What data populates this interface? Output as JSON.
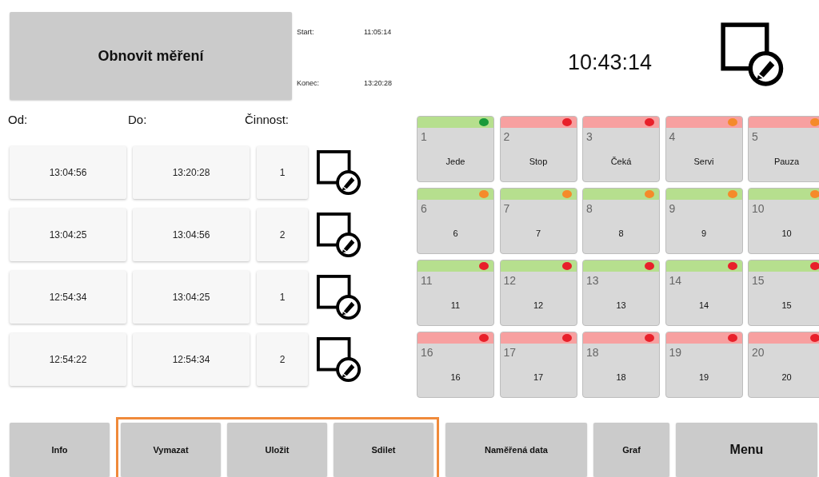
{
  "refresh_button": "Obnovit měření",
  "times": [
    {
      "label": "Start:",
      "value": "11:05:14"
    },
    {
      "label": "Konec:",
      "value": "13:20:28"
    }
  ],
  "clock": "10:43:14",
  "headers": [
    "Od:",
    "Do:",
    "Činnost:"
  ],
  "rows": [
    {
      "from": "13:04:56",
      "to": "13:20:28",
      "activity": "1"
    },
    {
      "from": "13:04:25",
      "to": "13:04:56",
      "activity": "2"
    },
    {
      "from": "12:54:34",
      "to": "13:04:25",
      "activity": "1"
    },
    {
      "from": "12:54:22",
      "to": "12:54:34",
      "activity": "2"
    }
  ],
  "tiles": [
    {
      "number": "1",
      "label": "Jede",
      "active": true,
      "color": "#1a9a3a"
    },
    {
      "number": "2",
      "label": "Stop",
      "active": false,
      "color": "#e8202a"
    },
    {
      "number": "3",
      "label": "Čeká",
      "active": false,
      "color": "#e8202a"
    },
    {
      "number": "4",
      "label": "Servi",
      "active": false,
      "color": "#f58a2a"
    },
    {
      "number": "5",
      "label": "Pauza",
      "active": false,
      "color": "#f58a2a"
    },
    {
      "number": "6",
      "label": "6",
      "active": true,
      "color": "#f58a2a"
    },
    {
      "number": "7",
      "label": "7",
      "active": true,
      "color": "#f58a2a"
    },
    {
      "number": "8",
      "label": "8",
      "active": true,
      "color": "#f58a2a"
    },
    {
      "number": "9",
      "label": "9",
      "active": true,
      "color": "#f58a2a"
    },
    {
      "number": "10",
      "label": "10",
      "active": true,
      "color": "#f58a2a"
    },
    {
      "number": "11",
      "label": "11",
      "active": true,
      "color": "#e8202a"
    },
    {
      "number": "12",
      "label": "12",
      "active": true,
      "color": "#e8202a"
    },
    {
      "number": "13",
      "label": "13",
      "active": true,
      "color": "#e8202a"
    },
    {
      "number": "14",
      "label": "14",
      "active": true,
      "color": "#e8202a"
    },
    {
      "number": "15",
      "label": "15",
      "active": true,
      "color": "#e8202a"
    },
    {
      "number": "16",
      "label": "16",
      "active": false,
      "color": "#e8202a"
    },
    {
      "number": "17",
      "label": "17",
      "active": false,
      "color": "#e8202a"
    },
    {
      "number": "18",
      "label": "18",
      "active": false,
      "color": "#e8202a"
    },
    {
      "number": "19",
      "label": "19",
      "active": false,
      "color": "#e8202a"
    },
    {
      "number": "20",
      "label": "20",
      "active": false,
      "color": "#e8202a"
    }
  ],
  "bottom_bar": [
    {
      "kind": "button",
      "label": "Info"
    },
    {
      "kind": "group",
      "buttons": [
        "Vymazat",
        "Uložit",
        "Sdilet"
      ]
    },
    {
      "kind": "wide",
      "label": "Naměřená data"
    },
    {
      "kind": "button",
      "label": "Graf"
    },
    {
      "kind": "menu",
      "label": "Menu"
    }
  ]
}
